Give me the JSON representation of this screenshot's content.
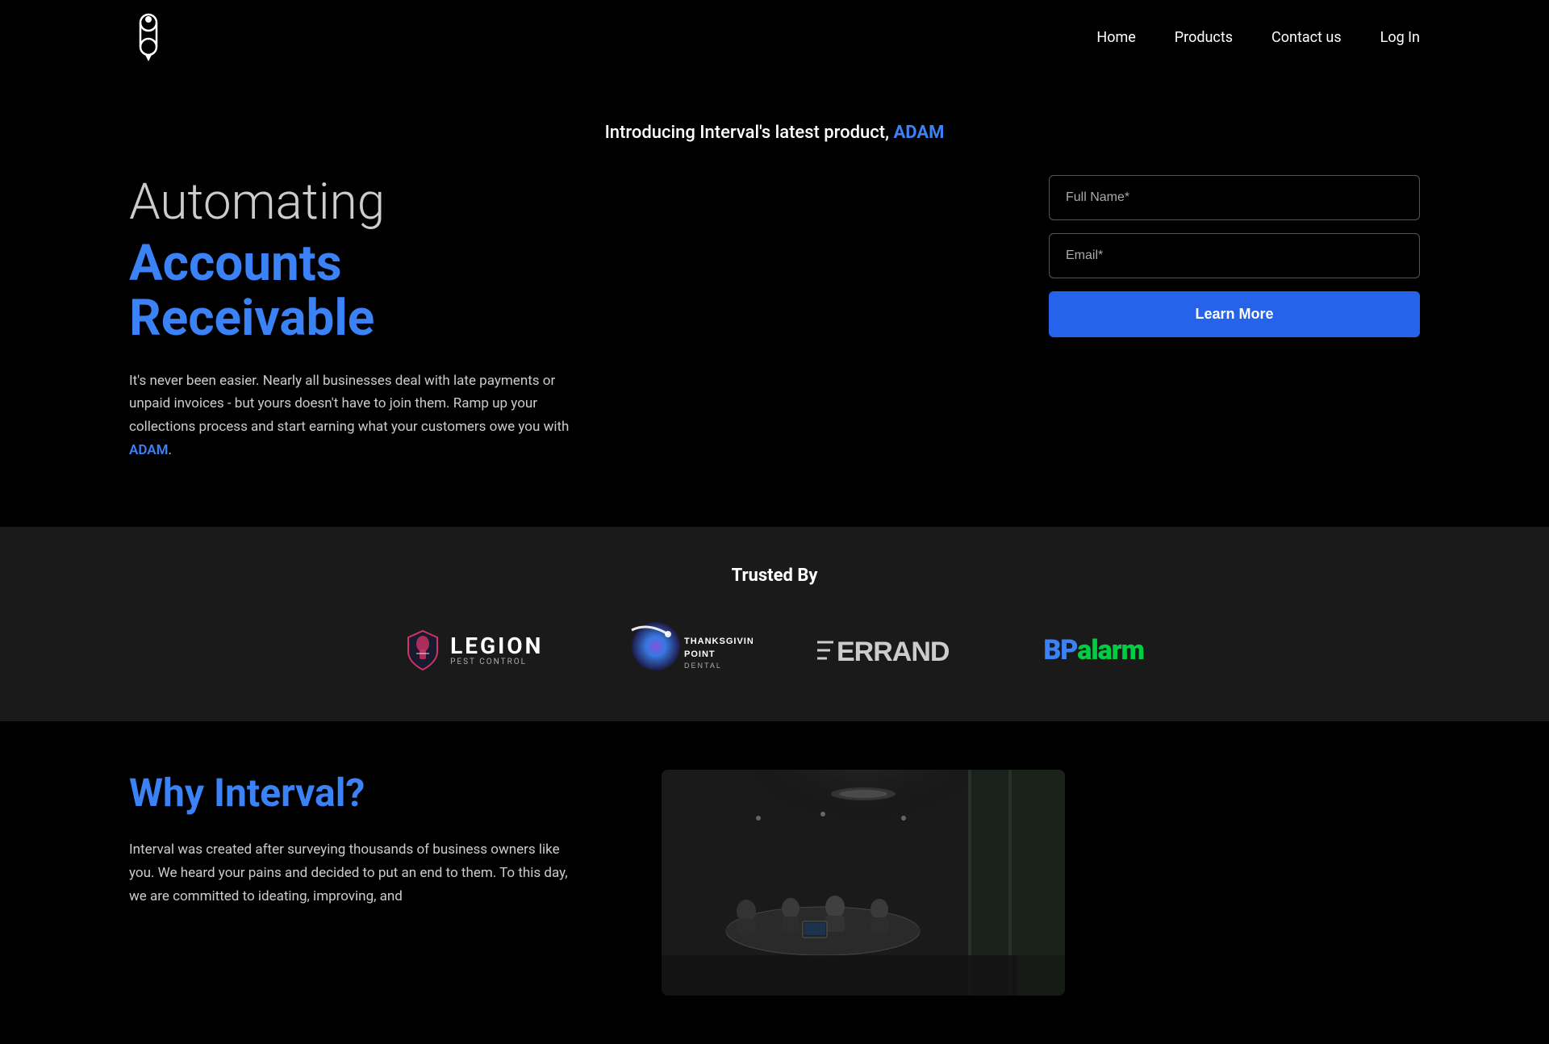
{
  "navbar": {
    "logo_alt": "Interval Logo",
    "links": [
      {
        "id": "home",
        "label": "Home"
      },
      {
        "id": "products",
        "label": "Products"
      },
      {
        "id": "contact",
        "label": "Contact us"
      },
      {
        "id": "login",
        "label": "Log In"
      }
    ]
  },
  "hero": {
    "introducing_prefix": "Introducing Interval's latest product,",
    "introducing_brand": "ADAM",
    "automating_label": "Automating",
    "accounts_receivable_label": "Accounts Receivable",
    "description": "It's never been easier. Nearly all businesses deal with late payments or unpaid invoices - but yours doesn't have to join them. Ramp up your collections process and start earning what your customers owe you with",
    "adam_link_label": "ADAM",
    "fullname_placeholder": "Full Name*",
    "email_placeholder": "Email*",
    "learn_more_label": "Learn More"
  },
  "trusted": {
    "title": "Trusted By",
    "logos": [
      {
        "id": "legion",
        "name": "Legion Pest Control"
      },
      {
        "id": "thanksgiving",
        "name": "Thanksgiving Point Dental"
      },
      {
        "id": "errand",
        "name": "Errand"
      },
      {
        "id": "bpalarm",
        "name": "BP Alarm"
      }
    ]
  },
  "why": {
    "title": "Why Interval?",
    "description": "Interval was created after surveying thousands of business owners like you. We heard your pains and decided to put an end to them. To this day, we are committed to ideating, improving, and"
  },
  "colors": {
    "blue_accent": "#3b82f6",
    "background": "#000000",
    "trusted_bg": "#1a1a1a"
  }
}
